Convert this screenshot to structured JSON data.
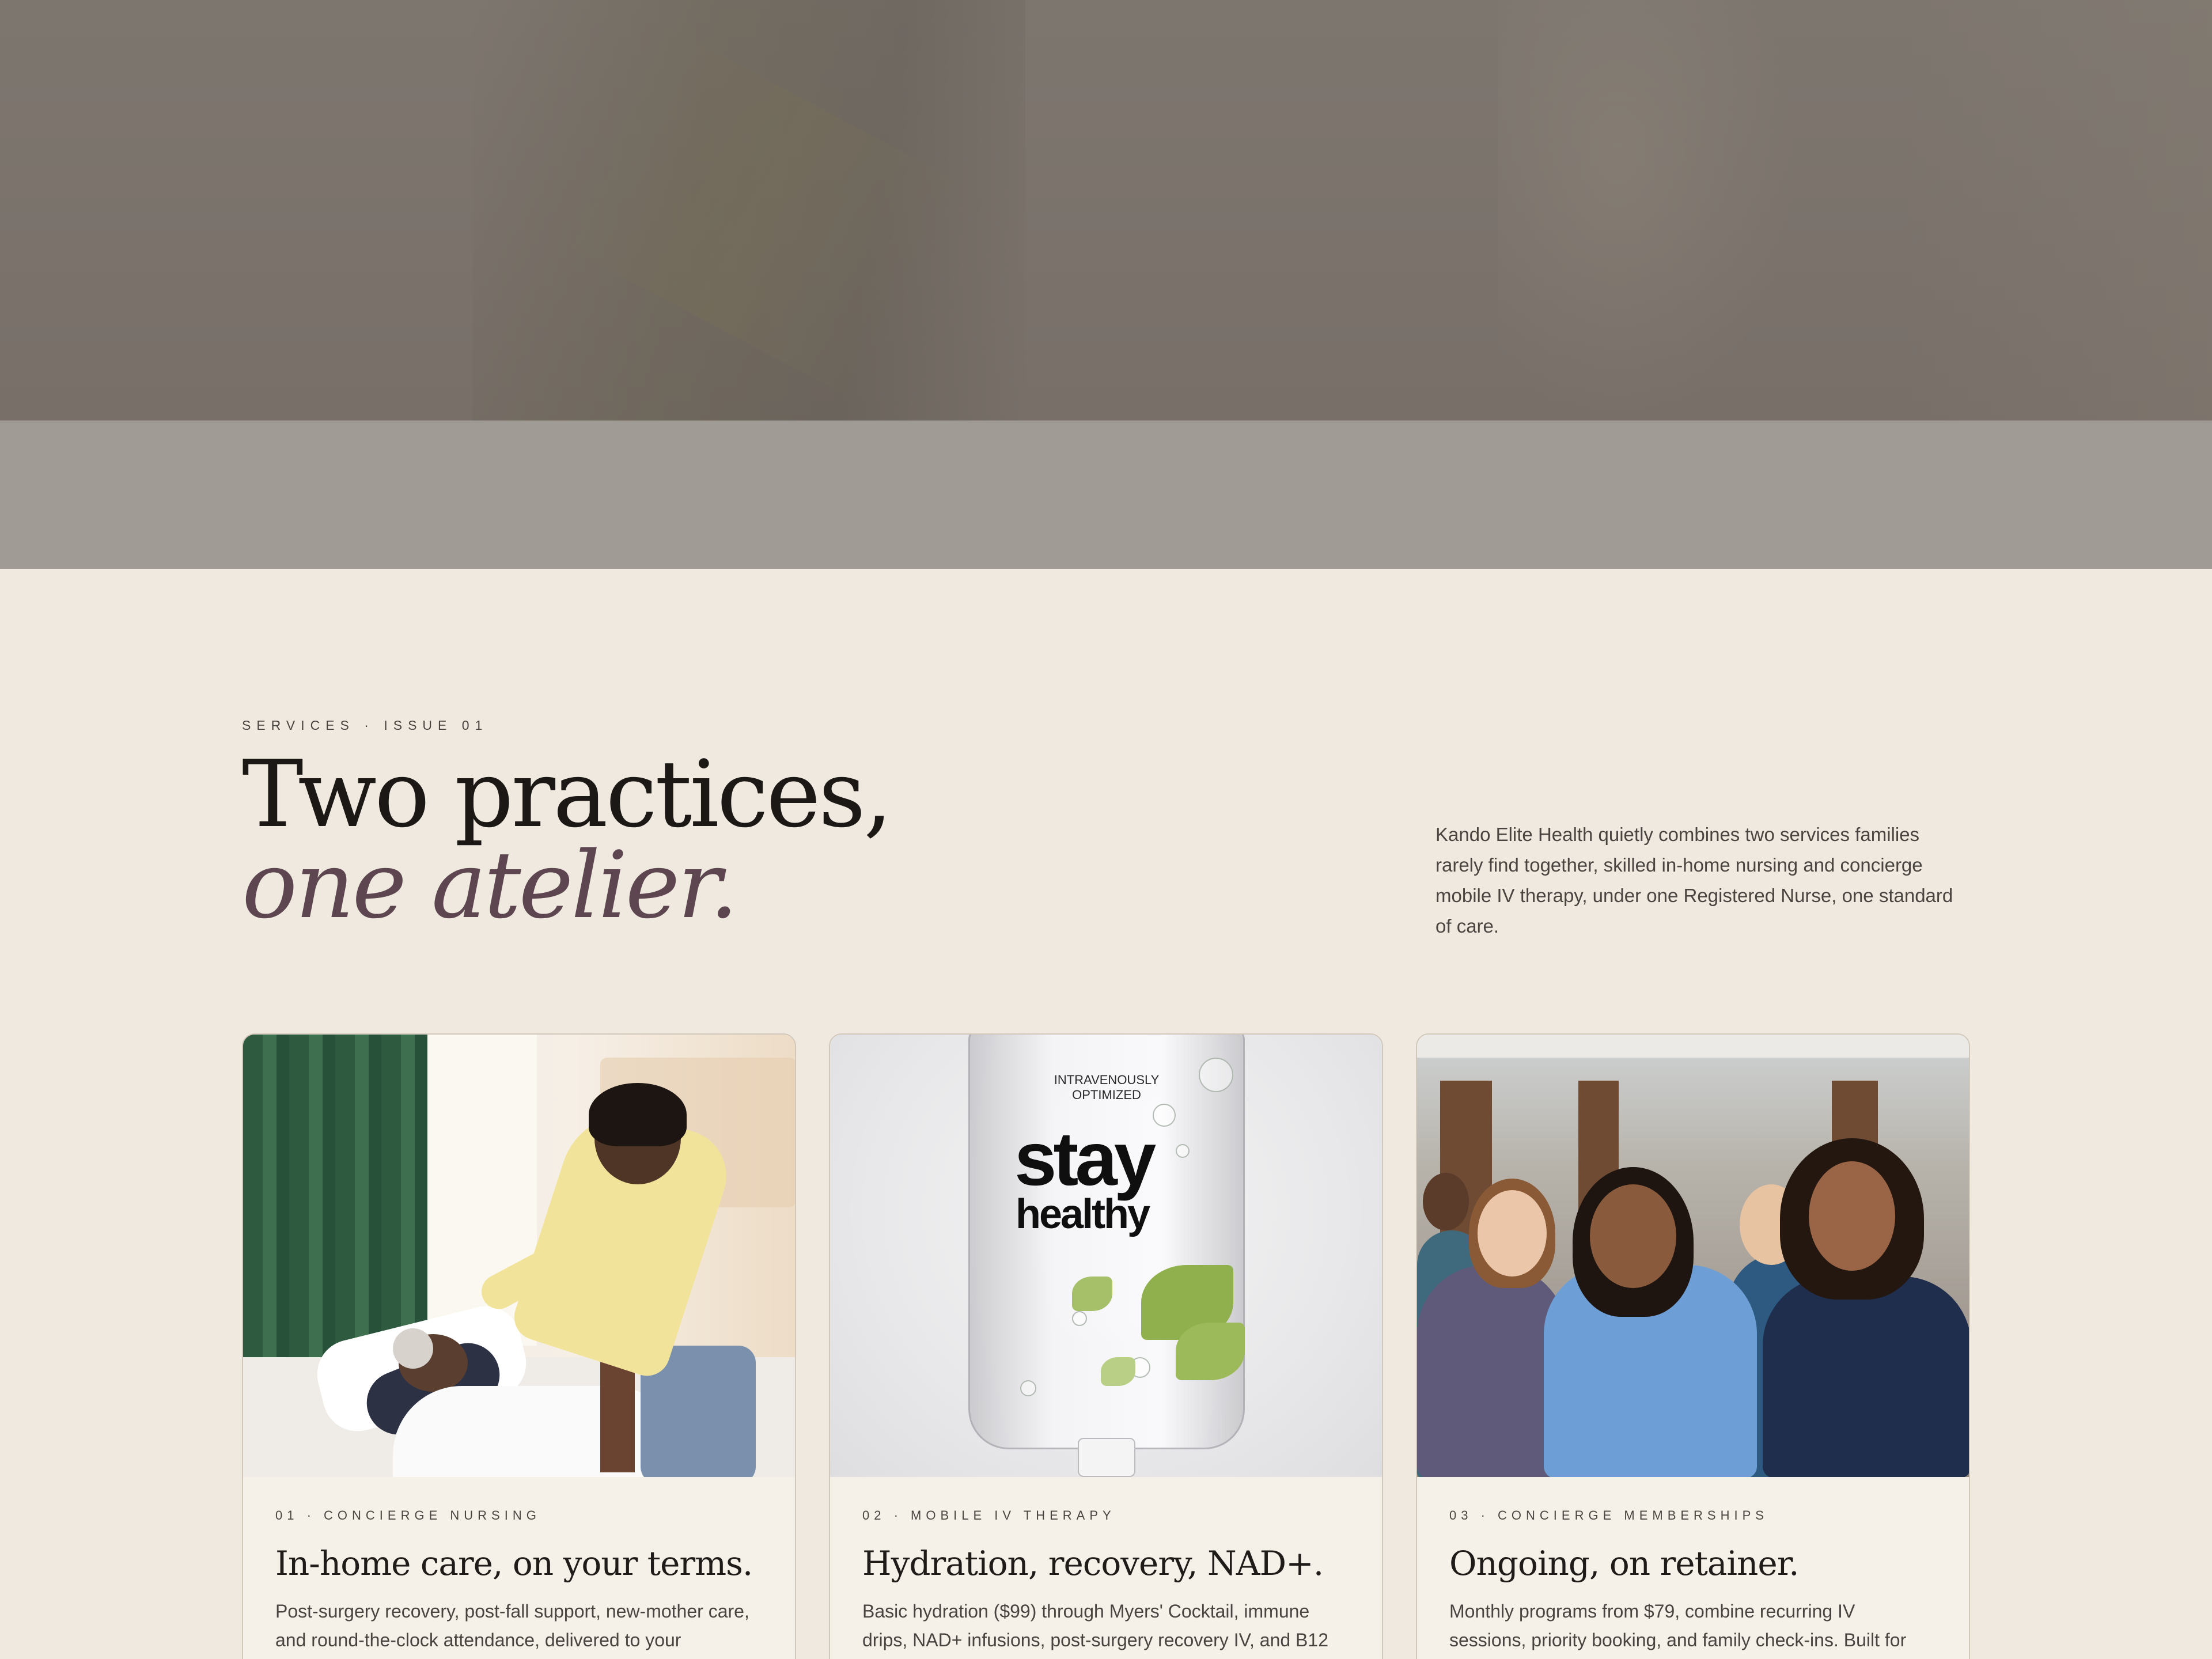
{
  "section": {
    "eyebrow": "SERVICES · ISSUE 01",
    "headline_plain": "Two practices, ",
    "headline_italic": "one atelier.",
    "intro": "Kando Elite Health quietly combines two services families rarely find together, skilled in-home nursing and concierge mobile IV therapy, under one Registered Nurse, one standard of care."
  },
  "cards": [
    {
      "kicker": "01 · CONCIERGE NURSING",
      "title": "In-home care, on your terms.",
      "description": "Post-surgery recovery, post-fall support, new-mother care, and round-the-clock attendance, delivered to your",
      "image": "nurse-caring-for-patient-in-bed"
    },
    {
      "kicker": "02 · MOBILE IV THERAPY",
      "title": "Hydration, recovery, NAD+.",
      "description": "Basic hydration ($99) through Myers' Cocktail, immune drips, NAD+ infusions, post-surgery recovery IV, and B12",
      "image": "iv-bag-stay-healthy",
      "bag_text": {
        "tagline_line1": "INTRAVENOUSLY",
        "tagline_line2": "OPTIMIZED",
        "big_line1": "stay",
        "big_line2": "healthy"
      }
    },
    {
      "kicker": "03 · CONCIERGE MEMBERSHIPS",
      "title": "Ongoing, on retainer.",
      "description": "Monthly programs from $79, combine recurring IV sessions, priority booking, and family check-ins. Built for",
      "image": "nursing-team-group-photo"
    }
  ],
  "colors": {
    "page_bg": "#efe9df",
    "accent_italic": "#5d4650",
    "card_bg": "#f5f1e8",
    "hero_band": "#a19b95"
  }
}
